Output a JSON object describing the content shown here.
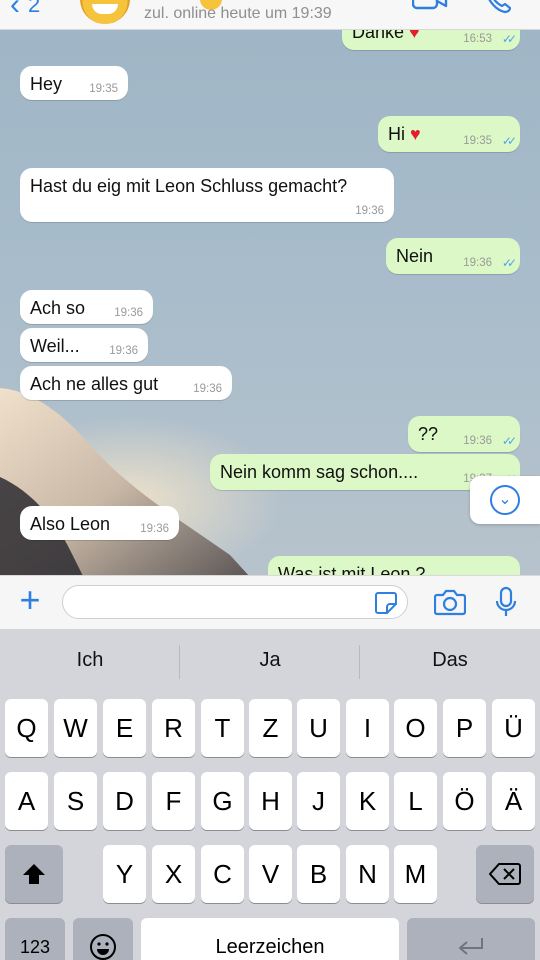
{
  "header": {
    "back_count": "2",
    "status": "zul. online heute um 19:39"
  },
  "messages": [
    {
      "dir": "out",
      "text": "Danke",
      "emoji": "heart",
      "time": "16:53",
      "ticks": true
    },
    {
      "dir": "in",
      "text": "Hey",
      "time": "19:35"
    },
    {
      "dir": "out",
      "text": "Hi",
      "emoji": "heart",
      "time": "19:35",
      "ticks": true
    },
    {
      "dir": "in",
      "text": "Hast du eig mit Leon Schluss gemacht?",
      "time": "19:36"
    },
    {
      "dir": "out",
      "text": "Nein",
      "time": "19:36",
      "ticks": true
    },
    {
      "dir": "in",
      "text": "Ach so",
      "time": "19:36"
    },
    {
      "dir": "in",
      "text": "Weil...",
      "time": "19:36"
    },
    {
      "dir": "in",
      "text": "Ach ne alles gut",
      "time": "19:36"
    },
    {
      "dir": "out",
      "text": "??",
      "time": "19:36",
      "ticks": true
    },
    {
      "dir": "out",
      "text": "Nein komm sag schon....",
      "time": "19:37",
      "ticks": true
    },
    {
      "dir": "in",
      "text": "Also Leon",
      "time": "19:36"
    },
    {
      "dir": "out",
      "text": "Was ist mit Leon ?",
      "time": "",
      "ticks": false
    }
  ],
  "input": {
    "placeholder": ""
  },
  "keyboard": {
    "suggestions": [
      "Ich",
      "Ja",
      "Das"
    ],
    "row1": [
      "Q",
      "W",
      "E",
      "R",
      "T",
      "Z",
      "U",
      "I",
      "O",
      "P",
      "Ü"
    ],
    "row2": [
      "A",
      "S",
      "D",
      "F",
      "G",
      "H",
      "J",
      "K",
      "L",
      "Ö",
      "Ä"
    ],
    "row3": [
      "Y",
      "X",
      "C",
      "V",
      "B",
      "N",
      "M"
    ],
    "numbers_label": "123",
    "space_label": "Leerzeichen"
  },
  "colors": {
    "accent": "#2f7fe0",
    "outgoing": "#dcf8c6",
    "incoming": "#ffffff",
    "read_ticks": "#4fa6ea"
  }
}
